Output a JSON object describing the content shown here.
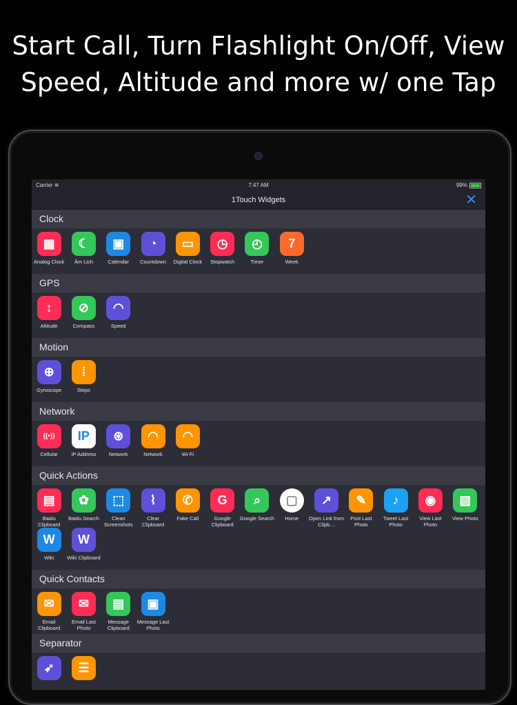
{
  "headline": {
    "line1": "Start Call, Turn Flashlight On/Off, View",
    "line2": "Speed, Altitude and more w/ one Tap"
  },
  "status": {
    "carrier": "Carrier",
    "time": "7:47 AM",
    "battery": "99%"
  },
  "nav": {
    "title": "1Touch Widgets",
    "close_glyph": "✕"
  },
  "colors": {
    "accent": "#3a8ef5",
    "background": "#2c2d36",
    "section_header": "#3a3b42"
  },
  "sections": [
    {
      "title": "Clock",
      "items": [
        {
          "label": "Analog Clock",
          "icon": "calendar-grid-icon",
          "color": "#ff2d55"
        },
        {
          "label": "Âm Lịch",
          "icon": "moon-calendar-icon",
          "color": "#34c759"
        },
        {
          "label": "Calendar",
          "icon": "calendar-icon",
          "color": "#1e88e5"
        },
        {
          "label": "Countdown",
          "icon": "countdown-icon",
          "color": "#5e50d8"
        },
        {
          "label": "Digital Clock",
          "icon": "digital-clock-icon",
          "color": "#ff9500"
        },
        {
          "label": "Stopwatch",
          "icon": "stopwatch-icon",
          "color": "#ff2d55"
        },
        {
          "label": "Timer",
          "icon": "timer-icon",
          "color": "#34c759"
        },
        {
          "label": "Week",
          "icon": "week-icon",
          "color": "#ff6a2c"
        }
      ]
    },
    {
      "title": "GPS",
      "items": [
        {
          "label": "Altitude",
          "icon": "altitude-icon",
          "color": "#ff2d55"
        },
        {
          "label": "Compass",
          "icon": "compass-icon",
          "color": "#34c759"
        },
        {
          "label": "Speed",
          "icon": "speed-icon",
          "color": "#5e50d8"
        }
      ]
    },
    {
      "title": "Motion",
      "items": [
        {
          "label": "Gyroscope",
          "icon": "gyroscope-icon",
          "color": "#5e50d8"
        },
        {
          "label": "Steps",
          "icon": "steps-icon",
          "color": "#ff9500"
        }
      ]
    },
    {
      "title": "Network",
      "items": [
        {
          "label": "Cellular",
          "icon": "cellular-icon",
          "color": "#ff2d55"
        },
        {
          "label": "IP Address",
          "icon": "ip-icon",
          "color": "#ffffff"
        },
        {
          "label": "Network",
          "icon": "globe-icon",
          "color": "#5e50d8"
        },
        {
          "label": "Network",
          "icon": "wifi-icon",
          "color": "#ff9500"
        },
        {
          "label": "Wi-Fi",
          "icon": "wifi-icon",
          "color": "#ff9500"
        }
      ]
    },
    {
      "title": "Quick Actions",
      "items": [
        {
          "label": "Baidu Clipboard",
          "icon": "baidu-clipboard-icon",
          "color": "#ff2d55"
        },
        {
          "label": "Baidu Search",
          "icon": "baidu-paw-icon",
          "color": "#34c759"
        },
        {
          "label": "Clean Screenshots",
          "icon": "screenshot-icon",
          "color": "#1e88e5"
        },
        {
          "label": "Clear Clipboard",
          "icon": "broom-icon",
          "color": "#5e50d8"
        },
        {
          "label": "Fake Call",
          "icon": "phone-icon",
          "color": "#ff9500"
        },
        {
          "label": "Google Clipboard",
          "icon": "google-clipboard-icon",
          "color": "#ff2d55"
        },
        {
          "label": "Google Search",
          "icon": "search-icon",
          "color": "#34c759"
        },
        {
          "label": "Home",
          "icon": "home-button-icon",
          "color": "#ffffff"
        },
        {
          "label": "Open Link from Clipb…",
          "icon": "open-link-icon",
          "color": "#5e50d8"
        },
        {
          "label": "Post Last Photo",
          "icon": "post-photo-icon",
          "color": "#ff9500"
        },
        {
          "label": "Tweet Last Photo",
          "icon": "twitter-icon",
          "color": "#1da1f2"
        },
        {
          "label": "View Last Photo",
          "icon": "view-photo-icon",
          "color": "#ff2d55"
        },
        {
          "label": "View Photo",
          "icon": "photo-icon",
          "color": "#34c759"
        },
        {
          "label": "Wiki",
          "icon": "wiki-icon",
          "color": "#1e88e5"
        },
        {
          "label": "Wiki Clipboard",
          "icon": "wiki-clipboard-icon",
          "color": "#5e50d8"
        }
      ]
    },
    {
      "title": "Quick Contacts",
      "items": [
        {
          "label": "Email Clipboard",
          "icon": "email-clipboard-icon",
          "color": "#ff9500"
        },
        {
          "label": "Email Last Photo",
          "icon": "email-photo-icon",
          "color": "#ff2d55"
        },
        {
          "label": "Message Clipboard",
          "icon": "message-clipboard-icon",
          "color": "#34c759"
        },
        {
          "label": "Message Last Photo",
          "icon": "message-photo-icon",
          "color": "#1e88e5"
        }
      ]
    },
    {
      "title": "Separator",
      "items": [
        {
          "label": "",
          "icon": "rocket-icon",
          "color": "#5e50d8"
        },
        {
          "label": "",
          "icon": "separator-icon",
          "color": "#ff9500"
        }
      ]
    }
  ]
}
